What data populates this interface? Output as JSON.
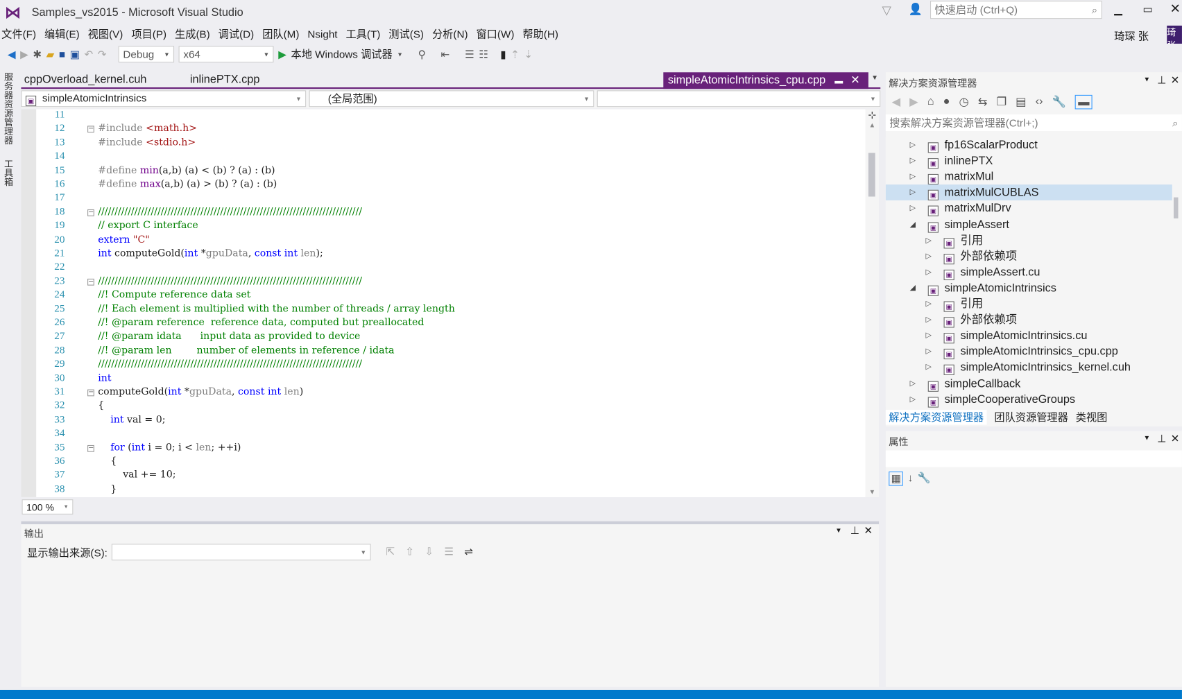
{
  "window": {
    "title": "Samples_vs2015 - Microsoft Visual Studio",
    "quick_launch_placeholder": "快速启动 (Ctrl+Q)",
    "user": "琦琛 张",
    "user_badge": "琦张"
  },
  "menu": [
    "文件(F)",
    "编辑(E)",
    "视图(V)",
    "项目(P)",
    "生成(B)",
    "调试(D)",
    "团队(M)",
    "Nsight",
    "工具(T)",
    "测试(S)",
    "分析(N)",
    "窗口(W)",
    "帮助(H)"
  ],
  "toolbar": {
    "config": "Debug",
    "platform": "x64",
    "start": "本地 Windows 调试器"
  },
  "left_rail": [
    "服务器资源管理器",
    "工具箱"
  ],
  "tabs": [
    "cppOverload_kernel.cuh",
    "inlinePTX.cpp",
    "simpleAtomicIntrinsics_cpu.cpp"
  ],
  "navbar": {
    "project": "simpleAtomicIntrinsics",
    "scope": "(全局范围)"
  },
  "zoom": "100 %",
  "code": [
    {
      "n": 11,
      "s": []
    },
    {
      "n": 12,
      "f": 1,
      "s": [
        [
          "pp",
          "#include "
        ],
        [
          "st",
          "<math.h>"
        ]
      ]
    },
    {
      "n": 13,
      "s": [
        [
          "pp",
          "#include "
        ],
        [
          "st",
          "<stdio.h>"
        ]
      ]
    },
    {
      "n": 14,
      "s": []
    },
    {
      "n": 15,
      "s": [
        [
          "pp",
          "#define "
        ],
        [
          "mc",
          "min"
        ],
        [
          "",
          "(a,b) (a) < (b) ? (a) : (b)"
        ]
      ]
    },
    {
      "n": 16,
      "s": [
        [
          "pp",
          "#define "
        ],
        [
          "mc",
          "max"
        ],
        [
          "",
          "(a,b) (a) > (b) ? (a) : (b)"
        ]
      ]
    },
    {
      "n": 17,
      "s": []
    },
    {
      "n": 18,
      "f": 1,
      "s": [
        [
          "cm",
          "////////////////////////////////////////////////////////////////////////////////"
        ]
      ]
    },
    {
      "n": 19,
      "s": [
        [
          "cm",
          "// export C interface"
        ]
      ]
    },
    {
      "n": 20,
      "s": [
        [
          "kw",
          "extern "
        ],
        [
          "st",
          "\"C\""
        ]
      ]
    },
    {
      "n": 21,
      "s": [
        [
          "kw",
          "int "
        ],
        [
          "",
          "computeGold("
        ],
        [
          "kw",
          "int "
        ],
        [
          "",
          "*"
        ],
        [
          "pm",
          "gpuData"
        ],
        [
          "",
          ", "
        ],
        [
          "kw",
          "const int "
        ],
        [
          "pm",
          "len"
        ],
        [
          "",
          ");"
        ]
      ]
    },
    {
      "n": 22,
      "s": []
    },
    {
      "n": 23,
      "f": 1,
      "s": [
        [
          "cm",
          "////////////////////////////////////////////////////////////////////////////////"
        ]
      ]
    },
    {
      "n": 24,
      "s": [
        [
          "cm",
          "//! Compute reference data set"
        ]
      ]
    },
    {
      "n": 25,
      "s": [
        [
          "cm",
          "//! Each element is multiplied with the number of threads / array length"
        ]
      ]
    },
    {
      "n": 26,
      "s": [
        [
          "cm",
          "//! @param reference  reference data, computed but preallocated"
        ]
      ]
    },
    {
      "n": 27,
      "s": [
        [
          "cm",
          "//! @param idata      input data as provided to device"
        ]
      ]
    },
    {
      "n": 28,
      "s": [
        [
          "cm",
          "//! @param len        number of elements in reference / idata"
        ]
      ]
    },
    {
      "n": 29,
      "s": [
        [
          "cm",
          "////////////////////////////////////////////////////////////////////////////////"
        ]
      ]
    },
    {
      "n": 30,
      "s": [
        [
          "kw",
          "int"
        ]
      ]
    },
    {
      "n": 31,
      "f": 1,
      "s": [
        [
          "",
          "computeGold("
        ],
        [
          "kw",
          "int "
        ],
        [
          "",
          "*"
        ],
        [
          "pm",
          "gpuData"
        ],
        [
          "",
          ", "
        ],
        [
          "kw",
          "const int "
        ],
        [
          "pm",
          "len"
        ],
        [
          "",
          ")"
        ]
      ]
    },
    {
      "n": 32,
      "s": [
        [
          "",
          "{"
        ]
      ]
    },
    {
      "n": 33,
      "s": [
        [
          "",
          "    "
        ],
        [
          "kw",
          "int "
        ],
        [
          "",
          "val = 0;"
        ]
      ]
    },
    {
      "n": 34,
      "s": []
    },
    {
      "n": 35,
      "f": 1,
      "s": [
        [
          "",
          "    "
        ],
        [
          "kw",
          "for "
        ],
        [
          "",
          "("
        ],
        [
          "kw",
          "int "
        ],
        [
          "",
          "i = 0; i < "
        ],
        [
          "pm",
          "len"
        ],
        [
          "",
          "; ++i)"
        ]
      ]
    },
    {
      "n": 36,
      "s": [
        [
          "",
          "    {"
        ]
      ]
    },
    {
      "n": 37,
      "s": [
        [
          "",
          "        val += 10;"
        ]
      ]
    },
    {
      "n": 38,
      "s": [
        [
          "",
          "    }"
        ]
      ]
    }
  ],
  "output": {
    "title": "输出",
    "source_label": "显示输出来源(S):",
    "source_value": ""
  },
  "solution_explorer": {
    "title": "解决方案资源管理器",
    "search_placeholder": "搜索解决方案资源管理器(Ctrl+;)",
    "items": [
      {
        "label": "fp16ScalarProduct",
        "lvl": 0,
        "exp": "c"
      },
      {
        "label": "inlinePTX",
        "lvl": 0,
        "exp": "c"
      },
      {
        "label": "matrixMul",
        "lvl": 0,
        "exp": "c"
      },
      {
        "label": "matrixMulCUBLAS",
        "lvl": 0,
        "exp": "c",
        "sel": true
      },
      {
        "label": "matrixMulDrv",
        "lvl": 0,
        "exp": "c"
      },
      {
        "label": "simpleAssert",
        "lvl": 0,
        "exp": "o"
      },
      {
        "label": "引用",
        "lvl": 1,
        "exp": "c"
      },
      {
        "label": "外部依赖项",
        "lvl": 1,
        "exp": "c"
      },
      {
        "label": "simpleAssert.cu",
        "lvl": 1,
        "exp": "c"
      },
      {
        "label": "simpleAtomicIntrinsics",
        "lvl": 0,
        "exp": "o"
      },
      {
        "label": "引用",
        "lvl": 1,
        "exp": "c"
      },
      {
        "label": "外部依赖项",
        "lvl": 1,
        "exp": "c"
      },
      {
        "label": "simpleAtomicIntrinsics.cu",
        "lvl": 1,
        "exp": "c"
      },
      {
        "label": "simpleAtomicIntrinsics_cpu.cpp",
        "lvl": 1,
        "exp": "c"
      },
      {
        "label": "simpleAtomicIntrinsics_kernel.cuh",
        "lvl": 1,
        "exp": "c"
      },
      {
        "label": "simpleCallback",
        "lvl": 0,
        "exp": "c"
      },
      {
        "label": "simpleCooperativeGroups",
        "lvl": 0,
        "exp": "c"
      }
    ],
    "bottom_tabs": [
      "解决方案资源管理器",
      "团队资源管理器",
      "类视图"
    ]
  },
  "properties": {
    "title": "属性"
  },
  "colors": {
    "accent": "#68217a",
    "status_bar": "#007acc"
  }
}
